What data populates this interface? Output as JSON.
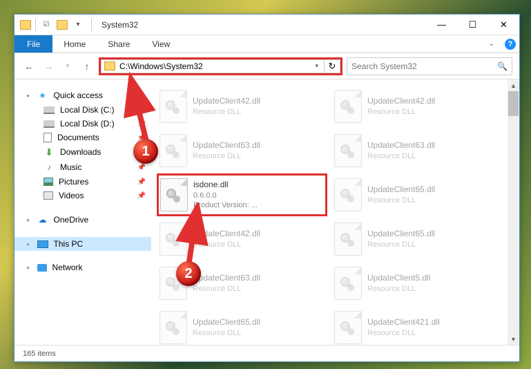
{
  "window": {
    "title": "System32"
  },
  "tabs": {
    "file": "File",
    "home": "Home",
    "share": "Share",
    "view": "View"
  },
  "nav": {
    "path": "C:\\Windows\\System32",
    "search_placeholder": "Search System32"
  },
  "sidebar": {
    "quick_access": "Quick access",
    "items": [
      {
        "label": "Local Disk (C:)"
      },
      {
        "label": "Local Disk (D:)"
      },
      {
        "label": "Documents"
      },
      {
        "label": "Downloads"
      },
      {
        "label": "Music"
      },
      {
        "label": "Pictures"
      },
      {
        "label": "Videos"
      }
    ],
    "onedrive": "OneDrive",
    "thispc": "This PC",
    "network": "Network"
  },
  "files": [
    {
      "name": "UpdateClient42.dll",
      "sub": "Resource DLL",
      "muted": true
    },
    {
      "name": "UpdateClient42.dll",
      "sub": "Resource DLL",
      "muted": true
    },
    {
      "name": "UpdateClient63.dll",
      "sub": "Resource DLL",
      "muted": true
    },
    {
      "name": "UpdateClient63.dll",
      "sub": "Resource DLL",
      "muted": true
    },
    {
      "name": "isdone.dll",
      "sub": "0.6.0.0",
      "sub2": "Product Version:    ...",
      "highlight": true
    },
    {
      "name": "UpdateClient65.dll",
      "sub": "Resource DLL",
      "muted": true
    },
    {
      "name": "UpdateClient42.dll",
      "sub": "Resource DLL",
      "muted": true
    },
    {
      "name": "UpdateClient65.dll",
      "sub": "Resource DLL",
      "muted": true
    },
    {
      "name": "UpdateClient63.dll",
      "sub": "Resource DLL",
      "muted": true
    },
    {
      "name": "UpdateClient5.dll",
      "sub": "Resource DLL",
      "muted": true
    },
    {
      "name": "UpdateClient65.dll",
      "sub": "Resource DLL",
      "muted": true
    },
    {
      "name": "UpdateClient421.dll",
      "sub": "Resource DLL",
      "muted": true
    }
  ],
  "status": {
    "count": "165 items"
  },
  "badges": {
    "b1": "1",
    "b2": "2"
  }
}
